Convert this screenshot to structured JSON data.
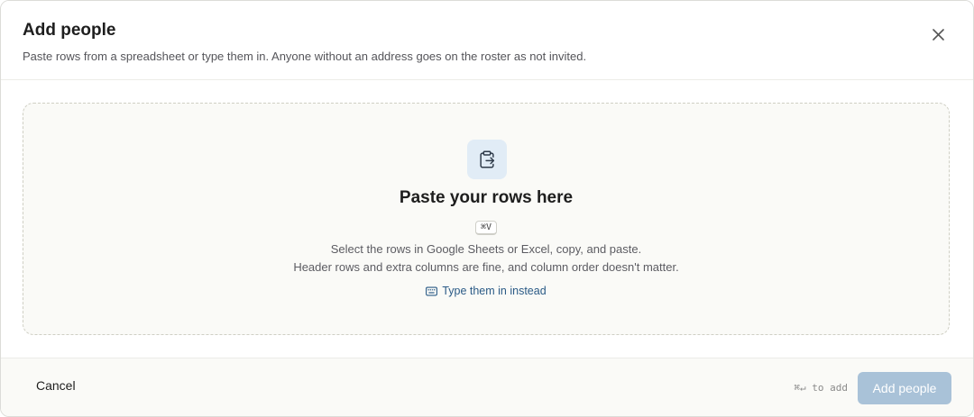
{
  "dialog": {
    "title": "Add people",
    "subtitle": "Paste rows from a spreadsheet or type them in. Anyone without an address goes on the roster as not invited.",
    "close_icon": "close-icon"
  },
  "dropzone": {
    "icon": "clipboard-paste-icon",
    "title": "Paste your rows here",
    "shortcut": "⌘V",
    "line1": "Select the rows in Google Sheets or Excel, copy, and paste.",
    "line2": "Header rows and extra columns are fine, and column order doesn't matter.",
    "type_link_icon": "keyboard-icon",
    "type_link": "Type them in instead"
  },
  "footer": {
    "cancel_label": "Cancel",
    "shortcut_hint": "⌘↵ to add",
    "submit_label": "Add people",
    "submit_disabled": true
  },
  "colors": {
    "accent": "#2a5a86",
    "submit_disabled_bg": "#a9c2d8",
    "icon_tile_bg": "#e1ecf6"
  }
}
